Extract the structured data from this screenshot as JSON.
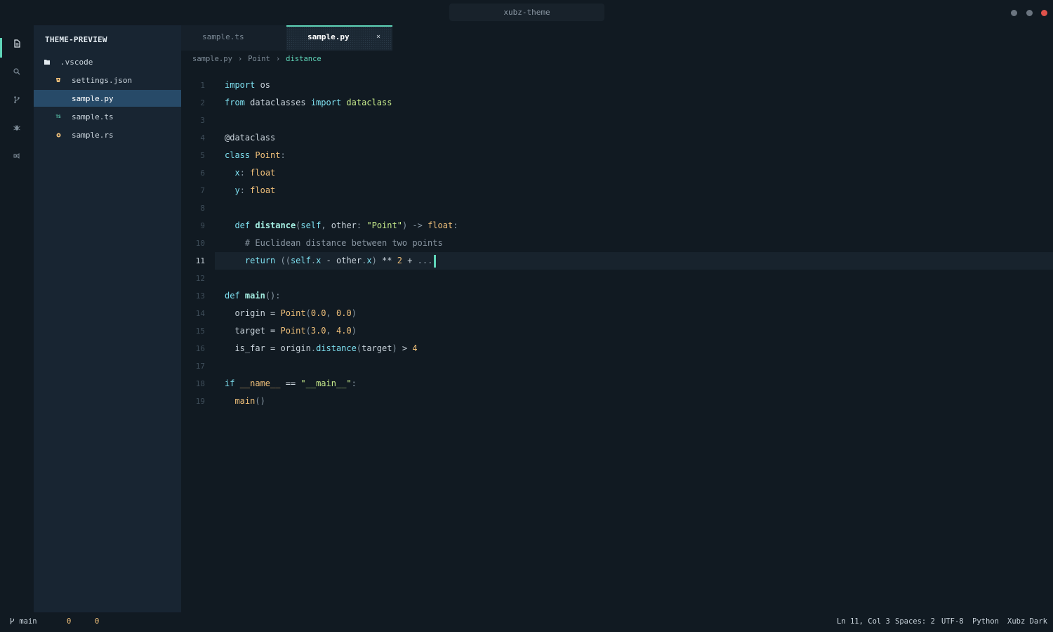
{
  "window": {
    "title": "xubz-theme"
  },
  "sidebar": {
    "title": "THEME-PREVIEW",
    "items": [
      {
        "label": ".vscode",
        "icon": "folder-icon"
      },
      {
        "label": "settings.json",
        "icon": "json-file-icon"
      },
      {
        "label": "sample.py",
        "icon": "python-file-icon",
        "selected": true
      },
      {
        "label": "sample.ts",
        "icon": "typescript-file-icon",
        "icon_text": "TS"
      },
      {
        "label": "sample.rs",
        "icon": "rust-file-icon"
      }
    ]
  },
  "tabs": [
    {
      "label": "sample.ts",
      "active": false
    },
    {
      "label": "sample.py",
      "active": true,
      "close": "×"
    }
  ],
  "breadcrumb": [
    "sample.py",
    "Point",
    "distance"
  ],
  "breadcrumb_separator": "›",
  "editor": {
    "current_line": 11,
    "lines": [
      {
        "n": "1"
      },
      {
        "n": "2"
      },
      {
        "n": "3"
      },
      {
        "n": "4"
      },
      {
        "n": "5"
      },
      {
        "n": "6"
      },
      {
        "n": "7"
      },
      {
        "n": "8"
      },
      {
        "n": "9"
      },
      {
        "n": "10"
      },
      {
        "n": "11"
      },
      {
        "n": "12"
      },
      {
        "n": "13"
      },
      {
        "n": "14"
      },
      {
        "n": "15"
      },
      {
        "n": "16"
      },
      {
        "n": "17"
      },
      {
        "n": "18"
      },
      {
        "n": "19"
      }
    ],
    "code": [
      [
        [
          "kw",
          "import"
        ],
        [
          "pl",
          " os"
        ]
      ],
      [
        [
          "kw",
          "from"
        ],
        [
          "pl",
          " dataclasses "
        ],
        [
          "kw",
          "import"
        ],
        [
          "st",
          " dataclass"
        ]
      ],
      [],
      [
        [
          "dc",
          "@dataclass"
        ]
      ],
      [
        [
          "kw",
          "class"
        ],
        [
          "pl",
          " "
        ],
        [
          "ty",
          "Point"
        ],
        [
          "pu",
          ":"
        ]
      ],
      [
        [
          "pl",
          "  "
        ],
        [
          "fn",
          "x"
        ],
        [
          "pu",
          ":"
        ],
        [
          "pl",
          " "
        ],
        [
          "ty",
          "float"
        ]
      ],
      [
        [
          "pl",
          "  "
        ],
        [
          "fn",
          "y"
        ],
        [
          "pu",
          ":"
        ],
        [
          "pl",
          " "
        ],
        [
          "ty",
          "float"
        ]
      ],
      [],
      [
        [
          "pl",
          "  "
        ],
        [
          "kw",
          "def"
        ],
        [
          "pl",
          " "
        ],
        [
          "fnb",
          "distance"
        ],
        [
          "pu",
          "("
        ],
        [
          "fn",
          "self"
        ],
        [
          "pu",
          ","
        ],
        [
          "pl",
          " other"
        ],
        [
          "pu",
          ":"
        ],
        [
          "pl",
          " "
        ],
        [
          "st",
          "\"Point\""
        ],
        [
          "pu",
          ")"
        ],
        [
          "pl",
          " "
        ],
        [
          "pu",
          "->"
        ],
        [
          "pl",
          " "
        ],
        [
          "ty",
          "float"
        ],
        [
          "pu",
          ":"
        ]
      ],
      [
        [
          "pl",
          "    "
        ],
        [
          "cm",
          "# Euclidean distance between two points"
        ]
      ],
      [
        [
          "pl",
          "    "
        ],
        [
          "kw",
          "return"
        ],
        [
          "pl",
          " "
        ],
        [
          "pu",
          "(("
        ],
        [
          "fn",
          "self"
        ],
        [
          "pu",
          "."
        ],
        [
          "fn",
          "x"
        ],
        [
          "pl",
          " - other"
        ],
        [
          "pu",
          "."
        ],
        [
          "fn",
          "x"
        ],
        [
          "pu",
          ")"
        ],
        [
          "pl",
          " ** "
        ],
        [
          "nu",
          "2"
        ],
        [
          "pl",
          " + "
        ],
        [
          "pu",
          "..."
        ]
      ],
      [],
      [
        [
          "kw",
          "def"
        ],
        [
          "pl",
          " "
        ],
        [
          "fnb",
          "main"
        ],
        [
          "pu",
          "():"
        ]
      ],
      [
        [
          "pl",
          "  origin = "
        ],
        [
          "ty",
          "Point"
        ],
        [
          "pu",
          "("
        ],
        [
          "nu",
          "0.0"
        ],
        [
          "pu",
          ","
        ],
        [
          "pl",
          " "
        ],
        [
          "nu",
          "0.0"
        ],
        [
          "pu",
          ")"
        ]
      ],
      [
        [
          "pl",
          "  target = "
        ],
        [
          "ty",
          "Point"
        ],
        [
          "pu",
          "("
        ],
        [
          "nu",
          "3.0"
        ],
        [
          "pu",
          ","
        ],
        [
          "pl",
          " "
        ],
        [
          "nu",
          "4.0"
        ],
        [
          "pu",
          ")"
        ]
      ],
      [
        [
          "pl",
          "  is_far = origin"
        ],
        [
          "pu",
          "."
        ],
        [
          "fn",
          "distance"
        ],
        [
          "pu",
          "("
        ],
        [
          "pl",
          "target"
        ],
        [
          "pu",
          ")"
        ],
        [
          "pl",
          " > "
        ],
        [
          "nu",
          "4"
        ]
      ],
      [],
      [
        [
          "kw",
          "if"
        ],
        [
          "pl",
          " "
        ],
        [
          "ty",
          "__name__"
        ],
        [
          "pl",
          " == "
        ],
        [
          "st",
          "\"__main__\""
        ],
        [
          "pu",
          ":"
        ]
      ],
      [
        [
          "pl",
          "  "
        ],
        [
          "ty",
          "main"
        ],
        [
          "pu",
          "()"
        ]
      ]
    ]
  },
  "statusbar": {
    "branch": "main",
    "errors": "0",
    "warnings": "0",
    "position": "Ln 11, Col 3",
    "spaces": "Spaces: 2",
    "encoding": "UTF-8",
    "language": "Python",
    "theme": "Xubz Dark"
  },
  "colors": {
    "accent": "#5fd4b8",
    "background": "#111a22",
    "sidebar": "#182532",
    "selection": "#274a68",
    "window_close": "#e0524b"
  }
}
